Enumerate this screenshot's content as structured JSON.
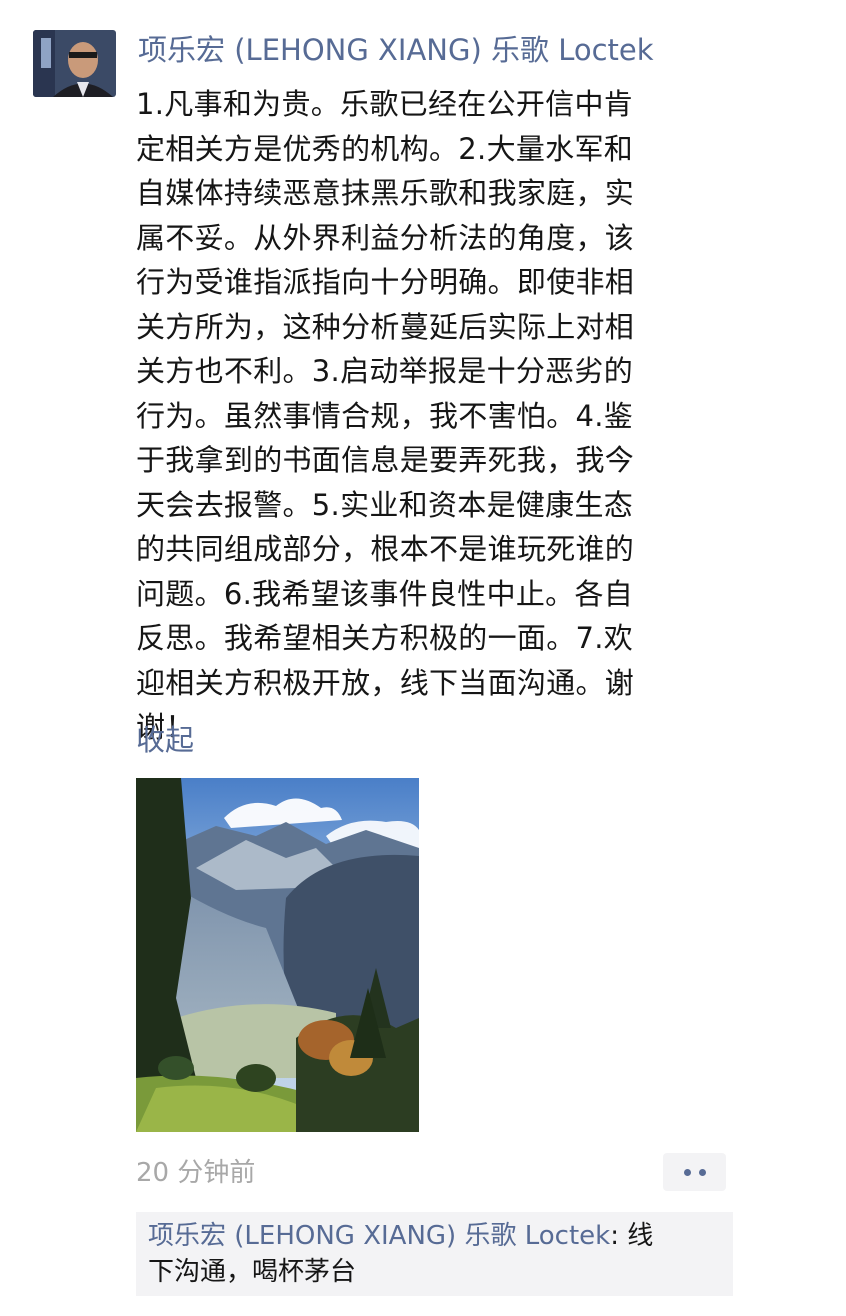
{
  "post": {
    "author_name": "项乐宏 (LEHONG XIANG) 乐歌 Loctek",
    "body_lines": [
      "1.凡事和为贵。乐歌已经在公开信中肯",
      "定相关方是优秀的机构。2.大量水军和",
      "自媒体持续恶意抹黑乐歌和我家庭，实",
      "属不妥。从外界利益分析法的角度，该",
      "行为受谁指派指向十分明确。即使非相",
      "关方所为，这种分析蔓延后实际上对相",
      "关方也不利。3.启动举报是十分恶劣的",
      "行为。虽然事情合规，我不害怕。4.鉴",
      "于我拿到的书面信息是要弄死我，我今",
      "天会去报警。5.实业和资本是健康生态",
      "的共同组成部分，根本不是谁玩死谁的",
      "问题。6.我希望该事件良性中止。各自",
      "反思。我希望相关方积极的一面。7.欢",
      "迎相关方积极开放，线下当面沟通。谢",
      "谢！"
    ],
    "collapse_label": "收起",
    "timestamp": "20 分钟前"
  },
  "comment": {
    "author": "项乐宏 (LEHONG XIANG) 乐歌 Loctek",
    "separator": ": ",
    "text_line1": "线",
    "text_line2": "下沟通，喝杯茅台"
  },
  "colors": {
    "link": "#576b95",
    "text": "#161616",
    "meta": "#a8a8a8",
    "panel": "#f3f3f5"
  },
  "icons": {
    "more": "more-dots-icon"
  }
}
